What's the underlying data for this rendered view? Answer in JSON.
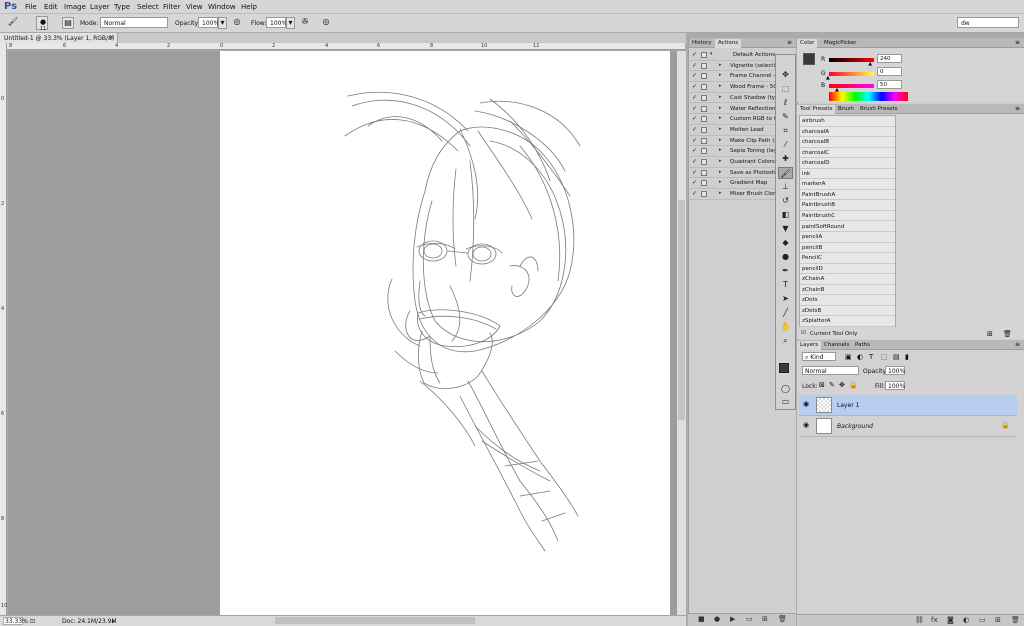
{
  "app": {
    "logo": "Ps",
    "menu": [
      "File",
      "Edit",
      "Image",
      "Layer",
      "Type",
      "Select",
      "Filter",
      "View",
      "Window",
      "Help"
    ],
    "workspace": "dw"
  },
  "options": {
    "brush_size": "11",
    "mode_label": "Mode:",
    "mode_value": "Normal",
    "opacity_label": "Opacity:",
    "opacity_value": "100%",
    "flow_label": "Flow:",
    "flow_value": "100%"
  },
  "document": {
    "tab_title": "Untitled-1 @ 33.3% (Layer 1, RGB/8) *",
    "zoom": "33.33%",
    "doc_info": "Doc: 24.1M/23.9M"
  },
  "ruler_top": [
    "8",
    "6",
    "4",
    "2",
    "0",
    "2",
    "4",
    "6",
    "8",
    "10",
    "12"
  ],
  "ruler_left": [
    "0",
    "2",
    "4",
    "6",
    "8",
    "10"
  ],
  "actions_panel": {
    "tabs": [
      "History",
      "Actions"
    ],
    "rows": [
      {
        "name": "Default Actions",
        "folder": true
      },
      {
        "name": "Vignette (selection)"
      },
      {
        "name": "Frame Channel - 50..."
      },
      {
        "name": "Wood Frame - 50 p..."
      },
      {
        "name": "Cast Shadow (type)"
      },
      {
        "name": "Water Reflection (t..."
      },
      {
        "name": "Custom RGB to Gr..."
      },
      {
        "name": "Molten Lead"
      },
      {
        "name": "Make Clip Path (se..."
      },
      {
        "name": "Sepia Toning (laye..."
      },
      {
        "name": "Quadrant Colors"
      },
      {
        "name": "Save as Photoshop..."
      },
      {
        "name": "Gradient Map"
      },
      {
        "name": "Mixer Brush Clonin..."
      }
    ]
  },
  "color_panel": {
    "tabs": [
      "Color",
      "MagicPicker"
    ],
    "r_label": "R",
    "g_label": "G",
    "b_label": "B",
    "r": "240",
    "g": "0",
    "b": "50",
    "r_fraction": 0.94,
    "g_fraction": 0.0,
    "b_fraction": 0.2,
    "fg_color": "#3a3a3a",
    "bg_color": "#ffffff"
  },
  "presets_panel": {
    "tabs": [
      "Tool Presets",
      "Brush",
      "Brush Presets"
    ],
    "items": [
      "airbrush",
      "charcoalA",
      "charcoalB",
      "charcoalC",
      "charcoalD",
      "ink",
      "markerA",
      "PaintBrushA",
      "PaintbrushB",
      "PaintbrushC",
      "paintSoftRound",
      "pencilA",
      "pencilB",
      "PencilC",
      "pencilD",
      "zChainA",
      "zChainB",
      "zDots",
      "zDotsB",
      "zSplatterA"
    ],
    "current_tool_only": "Current Tool Only"
  },
  "layers_panel": {
    "tabs": [
      "Layers",
      "Channels",
      "Paths"
    ],
    "kind": "Kind",
    "blend_mode": "Normal",
    "opacity_label": "Opacity:",
    "opacity_value": "100%",
    "lock_label": "Lock:",
    "fill_label": "Fill:",
    "fill_value": "100%",
    "layers": [
      {
        "name": "Layer 1",
        "selected": true
      },
      {
        "name": "Background",
        "selected": false
      }
    ],
    "selection_color": "#b6cdef"
  },
  "tools": [
    "move-icon",
    "marquee-icon",
    "lasso-icon",
    "quick-select-icon",
    "crop-icon",
    "eyedropper-icon",
    "healing-icon",
    "brush-icon",
    "stamp-icon",
    "history-brush-icon",
    "eraser-icon",
    "bucket-icon",
    "blur-icon",
    "dodge-icon",
    "pen-icon",
    "type-icon",
    "path-select-icon",
    "line-icon",
    "hand-icon",
    "zoom-icon"
  ]
}
